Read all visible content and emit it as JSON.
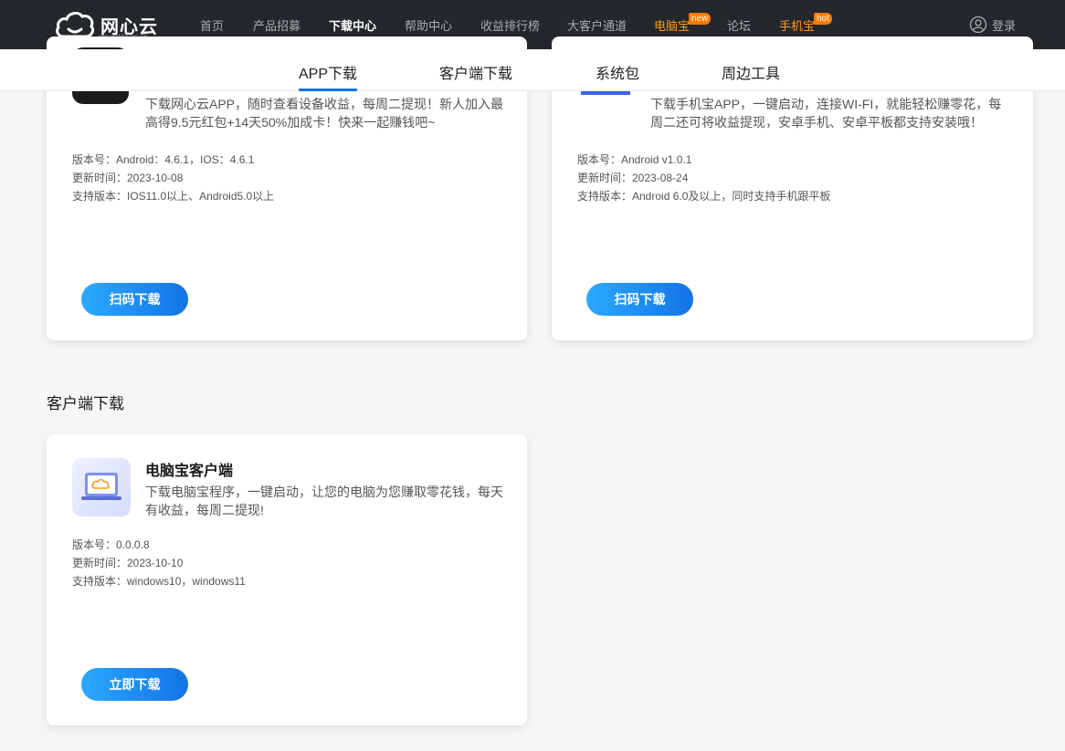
{
  "nav": {
    "brand": "网心云",
    "brand_url": "www.onethingcloud.com",
    "items": [
      {
        "label": "首页"
      },
      {
        "label": "产品招募"
      },
      {
        "label": "下载中心"
      },
      {
        "label": "帮助中心"
      },
      {
        "label": "收益排行榜"
      },
      {
        "label": "大客户通道"
      },
      {
        "label": "电脑宝",
        "badge": "new"
      },
      {
        "label": "论坛"
      },
      {
        "label": "手机宝",
        "badge": "hot"
      }
    ],
    "login": "登录"
  },
  "subnav": {
    "tabs": [
      {
        "label": "APP下载"
      },
      {
        "label": "客户端下载"
      },
      {
        "label": "系统包"
      },
      {
        "label": "周边工具"
      }
    ]
  },
  "cards": {
    "app": {
      "desc": "下载网心云APP，随时查看设备收益，每周二提现！新人加入最高得9.5元红包+14天50%加成卡！快来一起赚钱吧~",
      "version": "版本号：Android：4.6.1，IOS：4.6.1",
      "updated": "更新时间：2023-10-08",
      "support": "支持版本：IOS11.0以上、Android5.0以上",
      "button": "扫码下载"
    },
    "phone": {
      "desc": "下载手机宝APP，一键启动，连接WI-FI，就能轻松赚零花，每周二还可将收益提现，安卓手机、安卓平板都支持安装哦！",
      "version": "版本号：Android v1.0.1",
      "updated": "更新时间：2023-08-24",
      "support": "支持版本：Android 6.0及以上，同时支持手机跟平板",
      "button": "扫码下载"
    },
    "pc": {
      "title": "电脑宝客户端",
      "desc": "下载电脑宝程序，一键启动，让您的电脑为您赚取零花钱，每天有收益，每周二提现!",
      "version": "版本号：0.0.0.8",
      "updated": "更新时间：2023-10-10",
      "support": "支持版本：windows10，windows11",
      "button": "立即下载"
    }
  },
  "sections": {
    "client_title": "客户端下载"
  },
  "colors": {
    "nav_bg": "#24272c",
    "accent": "#1473e6",
    "orange": "#ff9a1f"
  }
}
